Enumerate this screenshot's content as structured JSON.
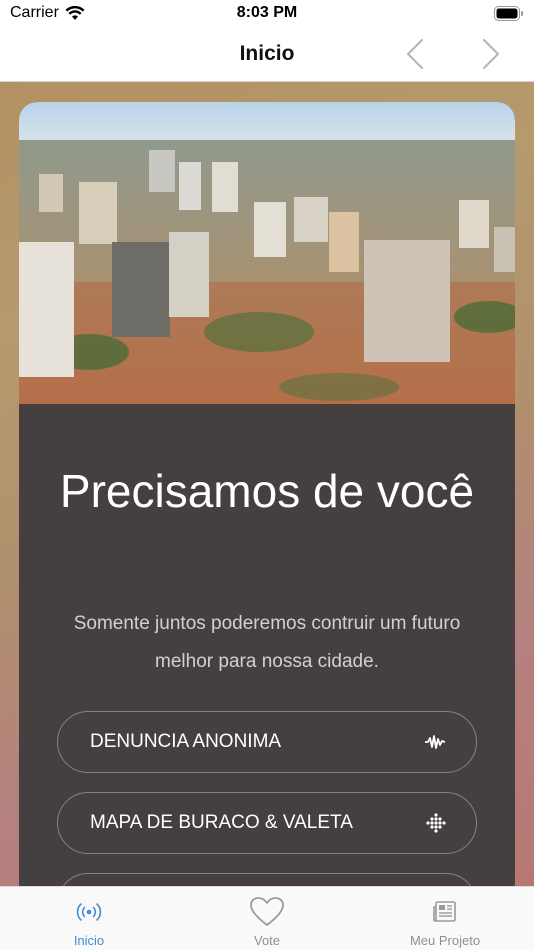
{
  "status": {
    "carrier": "Carrier",
    "time": "8:03 PM"
  },
  "nav": {
    "title": "Inicio",
    "back_icon": "chevron-left-icon",
    "forward_icon": "chevron-right-icon"
  },
  "card": {
    "title": "Precisamos de você",
    "subtitle": "Somente juntos poderemos contruir um futuro melhor para nossa cidade.",
    "actions": [
      {
        "label": "DENUNCIA ANONIMA",
        "icon": "audio-wave-icon"
      },
      {
        "label": "MAPA DE BURACO & VALETA",
        "icon": "dots-grid-icon"
      },
      {
        "label": "",
        "icon": ""
      }
    ]
  },
  "tabs": [
    {
      "label": "Inicio",
      "icon": "broadcast-icon",
      "active": true
    },
    {
      "label": "Vote",
      "icon": "heart-icon",
      "active": false
    },
    {
      "label": "Meu Projeto",
      "icon": "newspaper-icon",
      "active": false
    }
  ],
  "colors": {
    "accent": "#3d8ed6",
    "card_bg": "#463f3f",
    "tab_inactive": "#8e8e8e"
  }
}
